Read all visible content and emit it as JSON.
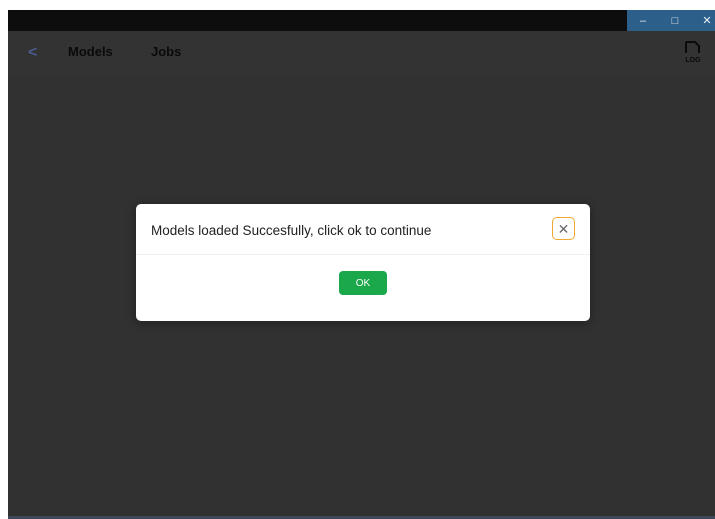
{
  "window_controls": {
    "minimize_glyph": "–",
    "maximize_glyph": "□",
    "close_glyph": "✕"
  },
  "appbar": {
    "back_glyph": "<",
    "nav": [
      {
        "label": "Models"
      },
      {
        "label": "Jobs"
      }
    ],
    "log_icon_text": "LOG"
  },
  "dialog": {
    "message": "Models loaded Succesfully, click ok to continue",
    "close_glyph": "✕",
    "ok_label": "OK"
  },
  "colors": {
    "background": "#313131",
    "titlebar": "#0d0d0d",
    "ok_button": "#1aa84a",
    "close_border": "#f0a830"
  }
}
